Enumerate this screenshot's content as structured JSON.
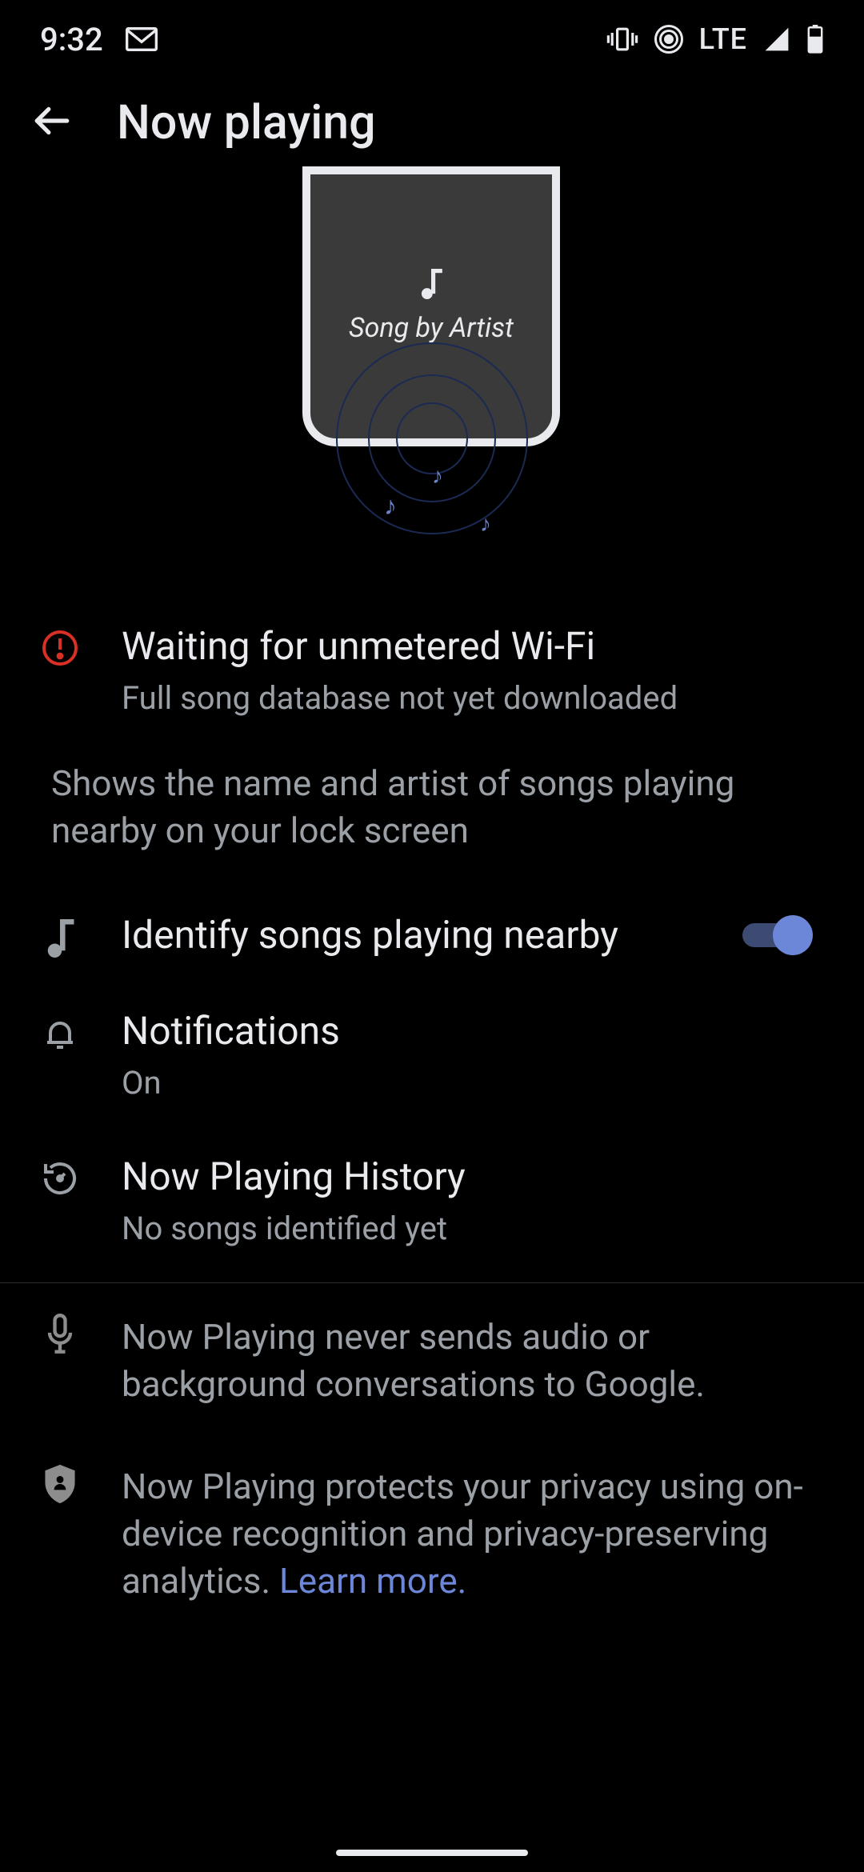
{
  "status": {
    "time": "9:32",
    "network": "LTE"
  },
  "header": {
    "title": "Now playing"
  },
  "illustration": {
    "phone_text": "Song by Artist"
  },
  "notice": {
    "title": "Waiting for unmetered Wi-Fi",
    "subtitle": "Full song database not yet downloaded"
  },
  "description": "Shows the name and artist of songs playing nearby on your lock screen",
  "settings": {
    "identify": {
      "label": "Identify songs playing nearby",
      "enabled": true
    },
    "notifications": {
      "label": "Notifications",
      "value": "On"
    },
    "history": {
      "label": "Now Playing History",
      "value": "No songs identified yet"
    }
  },
  "info": {
    "audio": "Now Playing never sends audio or background conversations to Google.",
    "privacy_prefix": "Now Playing protects your privacy using on-device recognition and privacy-preserving analytics. ",
    "privacy_link": "Learn more."
  }
}
